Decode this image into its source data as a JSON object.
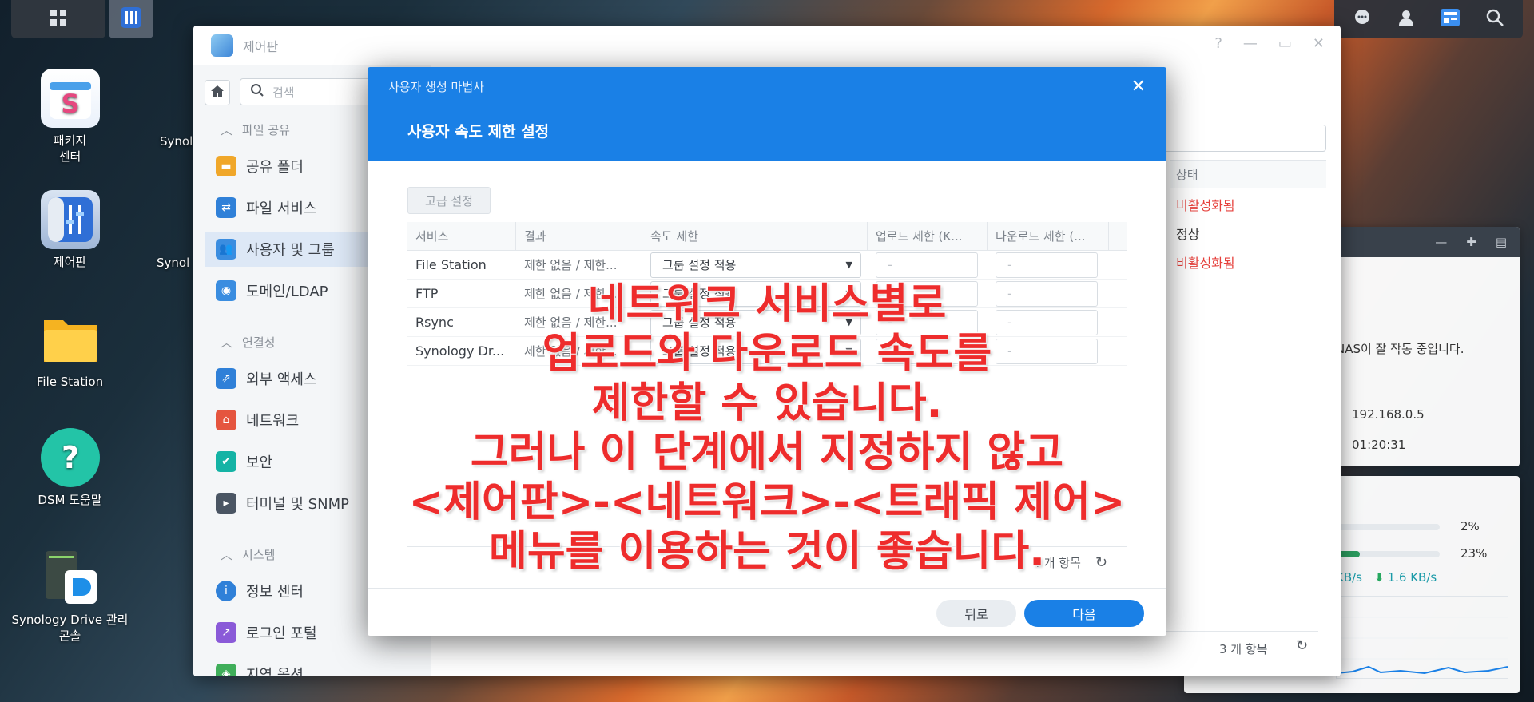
{
  "taskbar": {
    "main_menu_icon": "grid-icon",
    "open_app_icon": "control-panel-icon",
    "right_icons": [
      "chat-icon",
      "user-icon",
      "widget-icon",
      "search-icon"
    ]
  },
  "desktop": {
    "icons": [
      {
        "label": "패키지\n센터",
        "icon": "package-center-icon"
      },
      {
        "label": "제어판",
        "icon": "control-panel-icon"
      },
      {
        "label": "File Station",
        "icon": "folder-icon"
      },
      {
        "label": "DSM 도움말",
        "icon": "help-icon"
      },
      {
        "label": "Synology Drive 관리\n콘솔",
        "icon": "drive-admin-icon"
      }
    ],
    "partial_labels": [
      "Synol",
      "Synol"
    ]
  },
  "control_panel": {
    "title": "제어판",
    "search_placeholder": "검색",
    "sections": [
      {
        "label": "파일 공유",
        "items": [
          "공유 폴더",
          "파일 서비스",
          "사용자 및 그룹",
          "도메인/LDAP"
        ]
      },
      {
        "label": "연결성",
        "items": [
          "외부 액세스",
          "네트워크",
          "보안",
          "터미널 및 SNMP"
        ]
      },
      {
        "label": "시스템",
        "items": [
          "정보 센터",
          "로그인 포털",
          "지역 옵션"
        ]
      }
    ],
    "active_item": "사용자 및 그룹",
    "status_header": "상태",
    "statuses": [
      "비활성화됨",
      "정상",
      "비활성화됨"
    ],
    "footer_count": "3 개 항목"
  },
  "widget": {
    "status_text": "NAS이 잘 작동 중입니다.",
    "ip": "192.168.0.5",
    "uptime": "01:20:31",
    "cpu": "2%",
    "ram": "23%",
    "upload": "KB/s",
    "download": "1.6 KB/s",
    "cpu_fraction": 0.02,
    "ram_fraction": 0.23
  },
  "wizard": {
    "window_title": "사용자 생성 마법사",
    "step_title": "사용자 속도 제한 설정",
    "advanced_button": "고급 설정",
    "columns": [
      "서비스",
      "결과",
      "속도 제한",
      "업로드 제한 (K...",
      "다운로드 제한 (..."
    ],
    "rows": [
      {
        "service": "File Station",
        "result": "제한 없음 / 제한...",
        "limit": "그룹 설정 적용",
        "upload": "-",
        "download": "-"
      },
      {
        "service": "FTP",
        "result": "제한 없음 / 제한...",
        "limit": "그룹 설정 적용",
        "upload": "-",
        "download": "-"
      },
      {
        "service": "Rsync",
        "result": "제한 없음 / 제한...",
        "limit": "그룹 설정 적용",
        "upload": "-",
        "download": "-"
      },
      {
        "service": "Synology Dr...",
        "result": "제한 없음 / 제한...",
        "limit": "그룹 설정 적용",
        "upload": "-",
        "download": "-"
      }
    ],
    "footer_count": "4 개 항목",
    "back_button": "뒤로",
    "next_button": "다음"
  },
  "overlay": {
    "lines": [
      "네트워크 서비스별로",
      "업로드와 다운로드 속도를",
      "제한할 수 있습니다.",
      "그러나 이 단계에서 지정하지 않고",
      "<제어판>-<네트워크>-<트래픽 제어>",
      "메뉴를 이용하는 것이 좋습니다."
    ]
  },
  "colors": {
    "accent": "#1a80e6",
    "disabled_red": "#e6413c",
    "overlay_red": "#ee2c2c"
  }
}
